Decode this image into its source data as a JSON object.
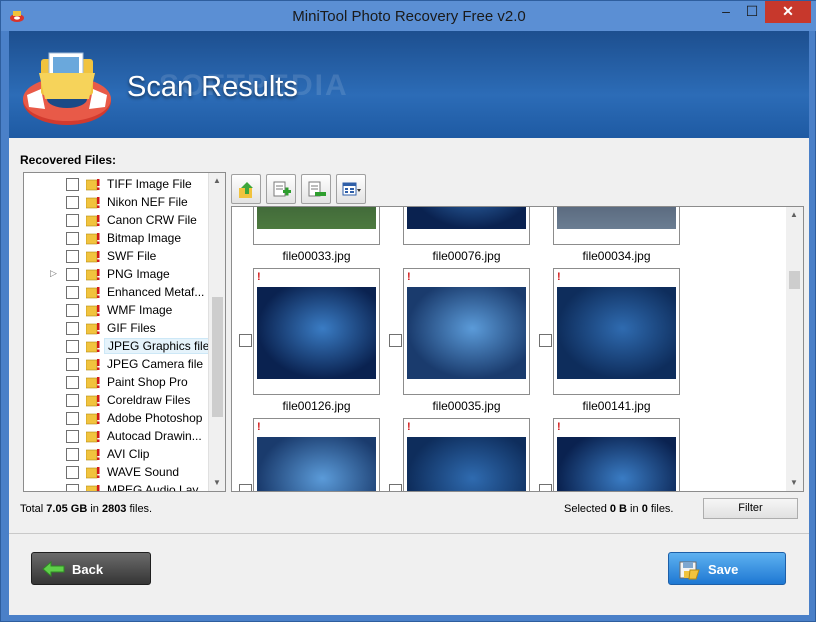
{
  "window": {
    "title": "MiniTool Photo Recovery Free v2.0",
    "minimize_glyph": "–",
    "maximize_glyph": "☐",
    "close_glyph": "✕"
  },
  "banner": {
    "heading": "Scan Results",
    "watermark": "SOFTPEDIA"
  },
  "tree": {
    "label": "Recovered Files:",
    "items": [
      {
        "label": "TIFF Image File"
      },
      {
        "label": "Nikon NEF File"
      },
      {
        "label": "Canon CRW File"
      },
      {
        "label": "Bitmap Image"
      },
      {
        "label": "SWF File"
      },
      {
        "label": "PNG Image",
        "expander": "▷"
      },
      {
        "label": "Enhanced Metaf..."
      },
      {
        "label": "WMF Image"
      },
      {
        "label": "GIF Files"
      },
      {
        "label": "JPEG Graphics file",
        "selected": true
      },
      {
        "label": "JPEG Camera file"
      },
      {
        "label": "Paint Shop Pro"
      },
      {
        "label": "Coreldraw Files"
      },
      {
        "label": "Adobe Photoshop"
      },
      {
        "label": "Autocad Drawin..."
      },
      {
        "label": "AVI Clip"
      },
      {
        "label": "WAVE Sound"
      },
      {
        "label": "MPEG Audio Lay..."
      }
    ]
  },
  "toolbar": {
    "icons": [
      "recover-up-icon",
      "add-select-icon",
      "remove-select-icon",
      "view-mode-icon"
    ]
  },
  "grid": {
    "rows": [
      [
        {
          "name": "file00033.jpg"
        },
        {
          "name": "file00076.jpg"
        },
        {
          "name": "file00034.jpg"
        }
      ],
      [
        {
          "name": "file00126.jpg",
          "flag": "!"
        },
        {
          "name": "file00035.jpg",
          "flag": "!"
        },
        {
          "name": "file00141.jpg",
          "flag": "!"
        }
      ],
      [
        {
          "name": "",
          "flag": "!"
        },
        {
          "name": "",
          "flag": "!"
        },
        {
          "name": "",
          "flag": "!"
        }
      ]
    ]
  },
  "status": {
    "total_prefix": "Total ",
    "total_size": "7.05 GB",
    "total_mid": " in ",
    "total_count": "2803",
    "total_suffix": " files.",
    "selected_prefix": "Selected ",
    "selected_size": "0 B",
    "selected_mid": " in ",
    "selected_count": "0",
    "selected_suffix": " files.",
    "filter_label": "Filter"
  },
  "buttons": {
    "back_label": "Back",
    "save_label": "Save"
  }
}
